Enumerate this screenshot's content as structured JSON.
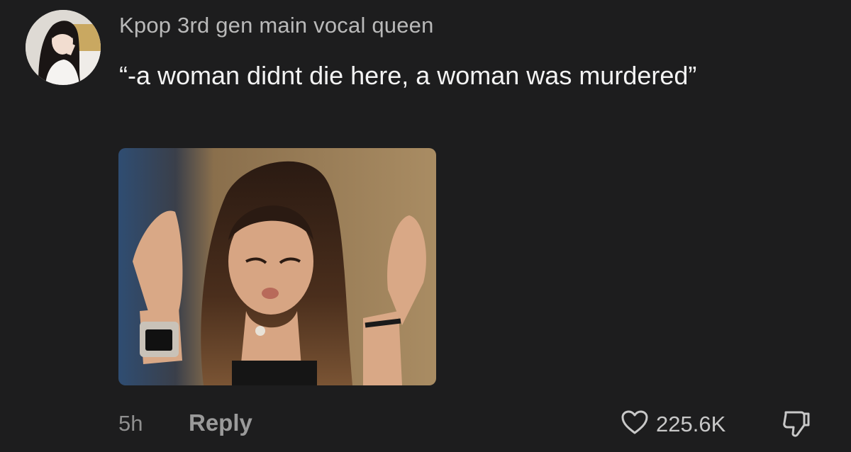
{
  "comment": {
    "username": "Kpop 3rd gen main vocal queen",
    "text": "“-a woman didnt die here, a woman was murdered”",
    "timestamp": "5h",
    "reply_label": "Reply",
    "like_count": "225.6K"
  },
  "icons": {
    "like": "heart-icon",
    "dislike": "thumbs-down-icon"
  },
  "colors": {
    "background": "#1d1d1e",
    "username": "#b9b9b9",
    "text": "#f3f3f3",
    "meta": "#8f8f8f"
  }
}
